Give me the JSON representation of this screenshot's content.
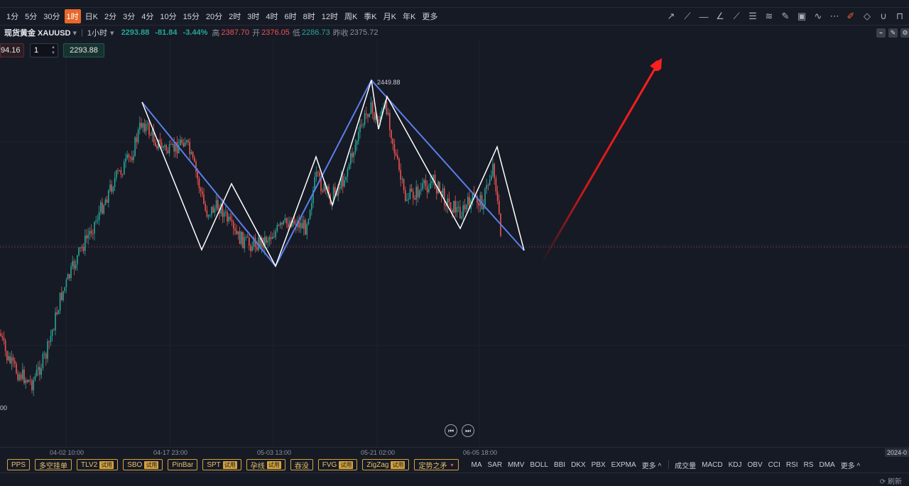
{
  "timeframes": [
    {
      "label": "1分",
      "active": false
    },
    {
      "label": "5分",
      "active": false
    },
    {
      "label": "30分",
      "active": false
    },
    {
      "label": "1时",
      "active": true
    },
    {
      "label": "日K",
      "active": false
    },
    {
      "label": "2分",
      "active": false
    },
    {
      "label": "3分",
      "active": false
    },
    {
      "label": "4分",
      "active": false
    },
    {
      "label": "10分",
      "active": false
    },
    {
      "label": "15分",
      "active": false
    },
    {
      "label": "20分",
      "active": false
    },
    {
      "label": "2时",
      "active": false
    },
    {
      "label": "3时",
      "active": false
    },
    {
      "label": "4时",
      "active": false
    },
    {
      "label": "6时",
      "active": false
    },
    {
      "label": "8时",
      "active": false
    },
    {
      "label": "12时",
      "active": false
    },
    {
      "label": "周K",
      "active": false
    },
    {
      "label": "季K",
      "active": false
    },
    {
      "label": "月K",
      "active": false
    },
    {
      "label": "年K",
      "active": false
    },
    {
      "label": "更多",
      "active": false
    }
  ],
  "drawing_tools": [
    {
      "name": "arrow-up-right-icon",
      "glyph": "↗"
    },
    {
      "name": "ray-icon",
      "glyph": "⟋"
    },
    {
      "name": "horizontal-line-icon",
      "glyph": "—"
    },
    {
      "name": "trend-angle-icon",
      "glyph": "∠"
    },
    {
      "name": "segment-icon",
      "glyph": "⟋"
    },
    {
      "name": "fibonacci-icon",
      "glyph": "☰"
    },
    {
      "name": "fan-icon",
      "glyph": "≋"
    },
    {
      "name": "brush-icon",
      "glyph": "✎"
    },
    {
      "name": "image-icon",
      "glyph": "▣"
    },
    {
      "name": "wave-icon",
      "glyph": "∿"
    },
    {
      "name": "more-tools-icon",
      "glyph": "⋯"
    },
    {
      "name": "edit-active-icon",
      "glyph": "✐"
    },
    {
      "name": "eraser-icon",
      "glyph": "◇"
    },
    {
      "name": "magnet-icon",
      "glyph": "∪"
    },
    {
      "name": "lock-icon",
      "glyph": "⊓"
    }
  ],
  "symbol": {
    "name": "现货黄金 XAUUSD",
    "interval": "1小时",
    "price": "2293.88",
    "change": "-81.84",
    "change_pct": "-3.44%",
    "high_label": "高",
    "high": "2387.70",
    "open_label": "开",
    "open": "2376.05",
    "low_label": "低",
    "low": "2286.73",
    "prev_label": "昨收",
    "prev": "2375.72"
  },
  "order": {
    "sell_price": "94.16",
    "quantity": "1",
    "buy_price": "2293.88"
  },
  "chart": {
    "peak_label": "2449.88",
    "left_price_label": "00",
    "date_labels": [
      "04-02 10:00",
      "04-17 23:00",
      "05-03 13:00",
      "05-21 02:00",
      "06-05 18:00"
    ],
    "right_date": "2024-0",
    "colors": {
      "up": "#26a69a",
      "down": "#ef5350",
      "zigzag_white": "#ffffff",
      "trend_blue": "#5b7fe8",
      "forecast_arrow": "#e01818",
      "grid": "#1f2330"
    }
  },
  "chart_data": {
    "type": "candlestick",
    "x": [
      "04-02 10:00",
      "04-17 23:00",
      "05-03 13:00",
      "05-21 02:00",
      "06-05 18:00"
    ],
    "peak": 2449.88,
    "last": 2293.88
  },
  "indicators": {
    "overlays": [
      {
        "label": "PPS",
        "trial": ""
      },
      {
        "label": "多空挂单",
        "trial": ""
      },
      {
        "label": "TLV2",
        "trial": "试用"
      },
      {
        "label": "SBO",
        "trial": "试用"
      },
      {
        "label": "PinBar",
        "trial": ""
      },
      {
        "label": "SPT",
        "trial": "试用"
      },
      {
        "label": "孕线",
        "trial": "试用"
      },
      {
        "label": "吞没",
        "trial": ""
      },
      {
        "label": "FVG",
        "trial": "试用"
      },
      {
        "label": "ZigZag",
        "trial": "试用"
      },
      {
        "label": "定势之矛",
        "trial": "▾"
      }
    ],
    "main": [
      "MA",
      "SAR",
      "MMV",
      "BOLL",
      "BBI",
      "DKX",
      "PBX",
      "EXPMA",
      "更多 ^"
    ],
    "sub": [
      "成交量",
      "MACD",
      "KDJ",
      "OBV",
      "CCI",
      "RSI",
      "RS",
      "DMA",
      "更多 ^"
    ]
  },
  "refresh_label": "刷新"
}
